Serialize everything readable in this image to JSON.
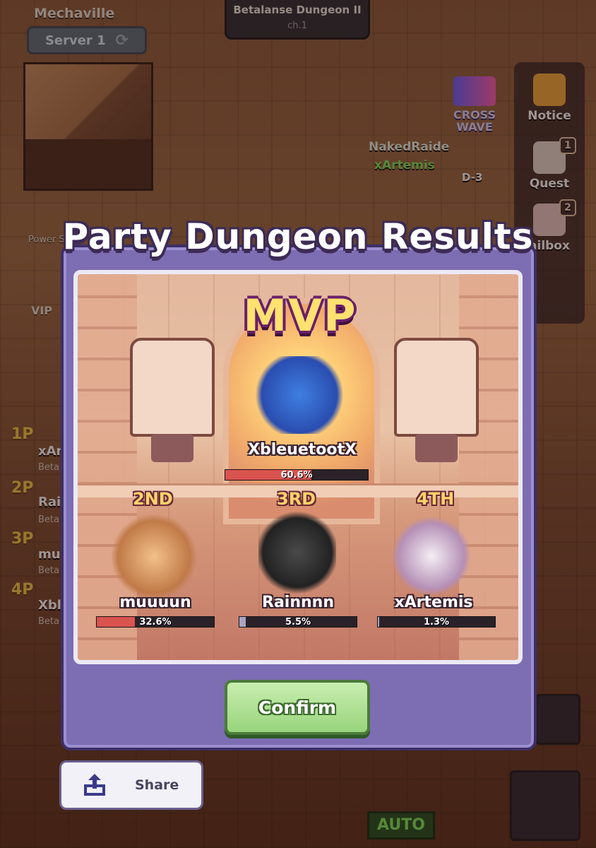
{
  "hud": {
    "town": "Mechaville",
    "server_label": "Server 1",
    "dungeon_name": "Betalanse Dungeon II",
    "chapter": "ch.1",
    "side_menu": [
      {
        "label": "Notice",
        "badge": ""
      },
      {
        "label": "Quest",
        "badge": "1"
      },
      {
        "label": "ailbox",
        "badge": "2"
      }
    ],
    "crosswave_label": "CROSS WAVE",
    "stage_tag": "D-3",
    "nearby_names": [
      "NakedRaide",
      "xArtemis"
    ],
    "left_labels": [
      "Power Saver",
      "VIP"
    ],
    "party_ranks": [
      {
        "rank": "1P",
        "name": "xAr",
        "sub": "Beta"
      },
      {
        "rank": "2P",
        "name": "Rai",
        "sub": "Beta"
      },
      {
        "rank": "3P",
        "name": "mu",
        "sub": "Beta"
      },
      {
        "rank": "4P",
        "name": "Xbl",
        "sub": "Beta"
      }
    ],
    "auto_label": "AUTO"
  },
  "modal": {
    "title": "Party Dungeon Results",
    "mvp_label": "MVP",
    "mvp": {
      "name": "XbleuetootX",
      "share": 60.6,
      "share_text": "60.6%"
    },
    "others": [
      {
        "place": "2ND",
        "name": "muuuun",
        "share": 32.6,
        "share_text": "32.6%"
      },
      {
        "place": "3RD",
        "name": "Rainnnn",
        "share": 5.5,
        "share_text": "5.5%"
      },
      {
        "place": "4TH",
        "name": "xArtemis",
        "share": 1.3,
        "share_text": "1.3%"
      }
    ],
    "confirm_label": "Confirm",
    "share_label": "Share"
  },
  "colors": {
    "modal_bg": "#7d6db3",
    "bar_fill_top": "#d9534f",
    "bar_fill_low": "#a9a4c2",
    "confirm_green": "#98d47c",
    "title_outline": "#3c2b55"
  }
}
